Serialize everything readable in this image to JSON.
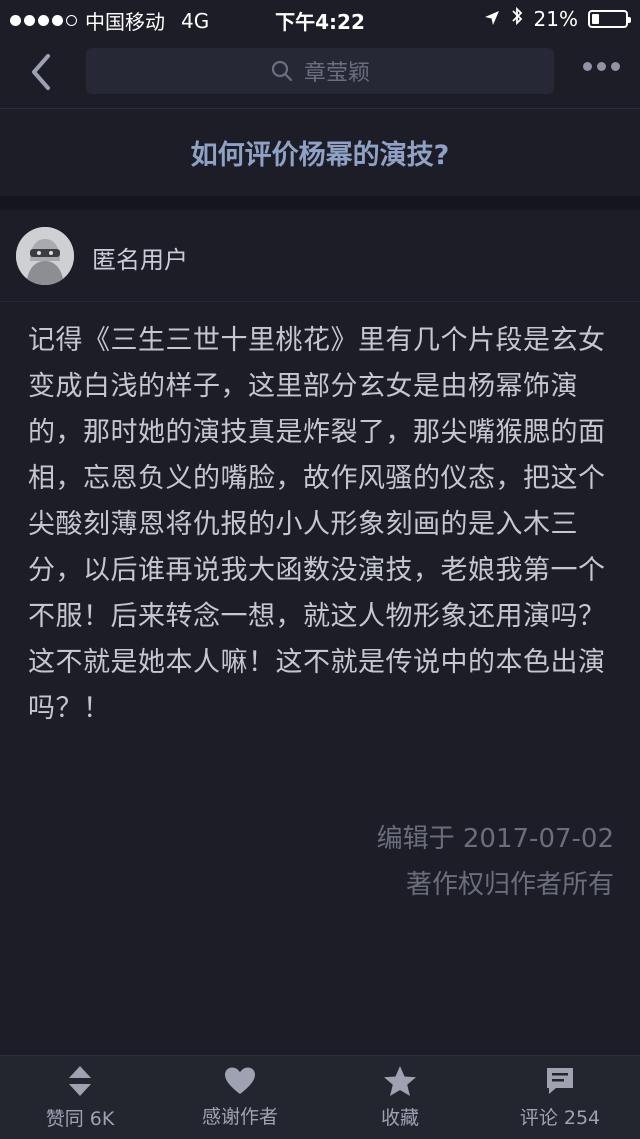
{
  "status_bar": {
    "carrier": "中国移动",
    "network": "4G",
    "time": "下午4:22",
    "battery_percent": "21%",
    "battery_level": 0.21
  },
  "nav": {
    "search_text": "章莹颖"
  },
  "question": {
    "title": "如何评价杨幂的演技?"
  },
  "author": {
    "name": "匿名用户"
  },
  "answer": {
    "text": "记得《三生三世十里桃花》里有几个片段是玄女变成白浅的样子，这里部分玄女是由杨幂饰演的，那时她的演技真是炸裂了，那尖嘴猴腮的面相，忘恩负义的嘴脸，故作风骚的仪态，把这个尖酸刻薄恩将仇报的小人形象刻画的是入木三分，以后谁再说我大函数没演技，老娘我第一个不服！后来转念一想，就这人物形象还用演吗？这不就是她本人嘛！这不就是传说中的本色出演吗？！",
    "edited": "编辑于 2017-07-02",
    "copyright": "著作权归作者所有"
  },
  "bottom_bar": {
    "upvote": "赞同 6K",
    "thank": "感谢作者",
    "favorite": "收藏",
    "comment": "评论 254"
  },
  "colors": {
    "background": "#1c1d26",
    "title": "#8fa2c5",
    "body_text": "#c4c7d0"
  }
}
